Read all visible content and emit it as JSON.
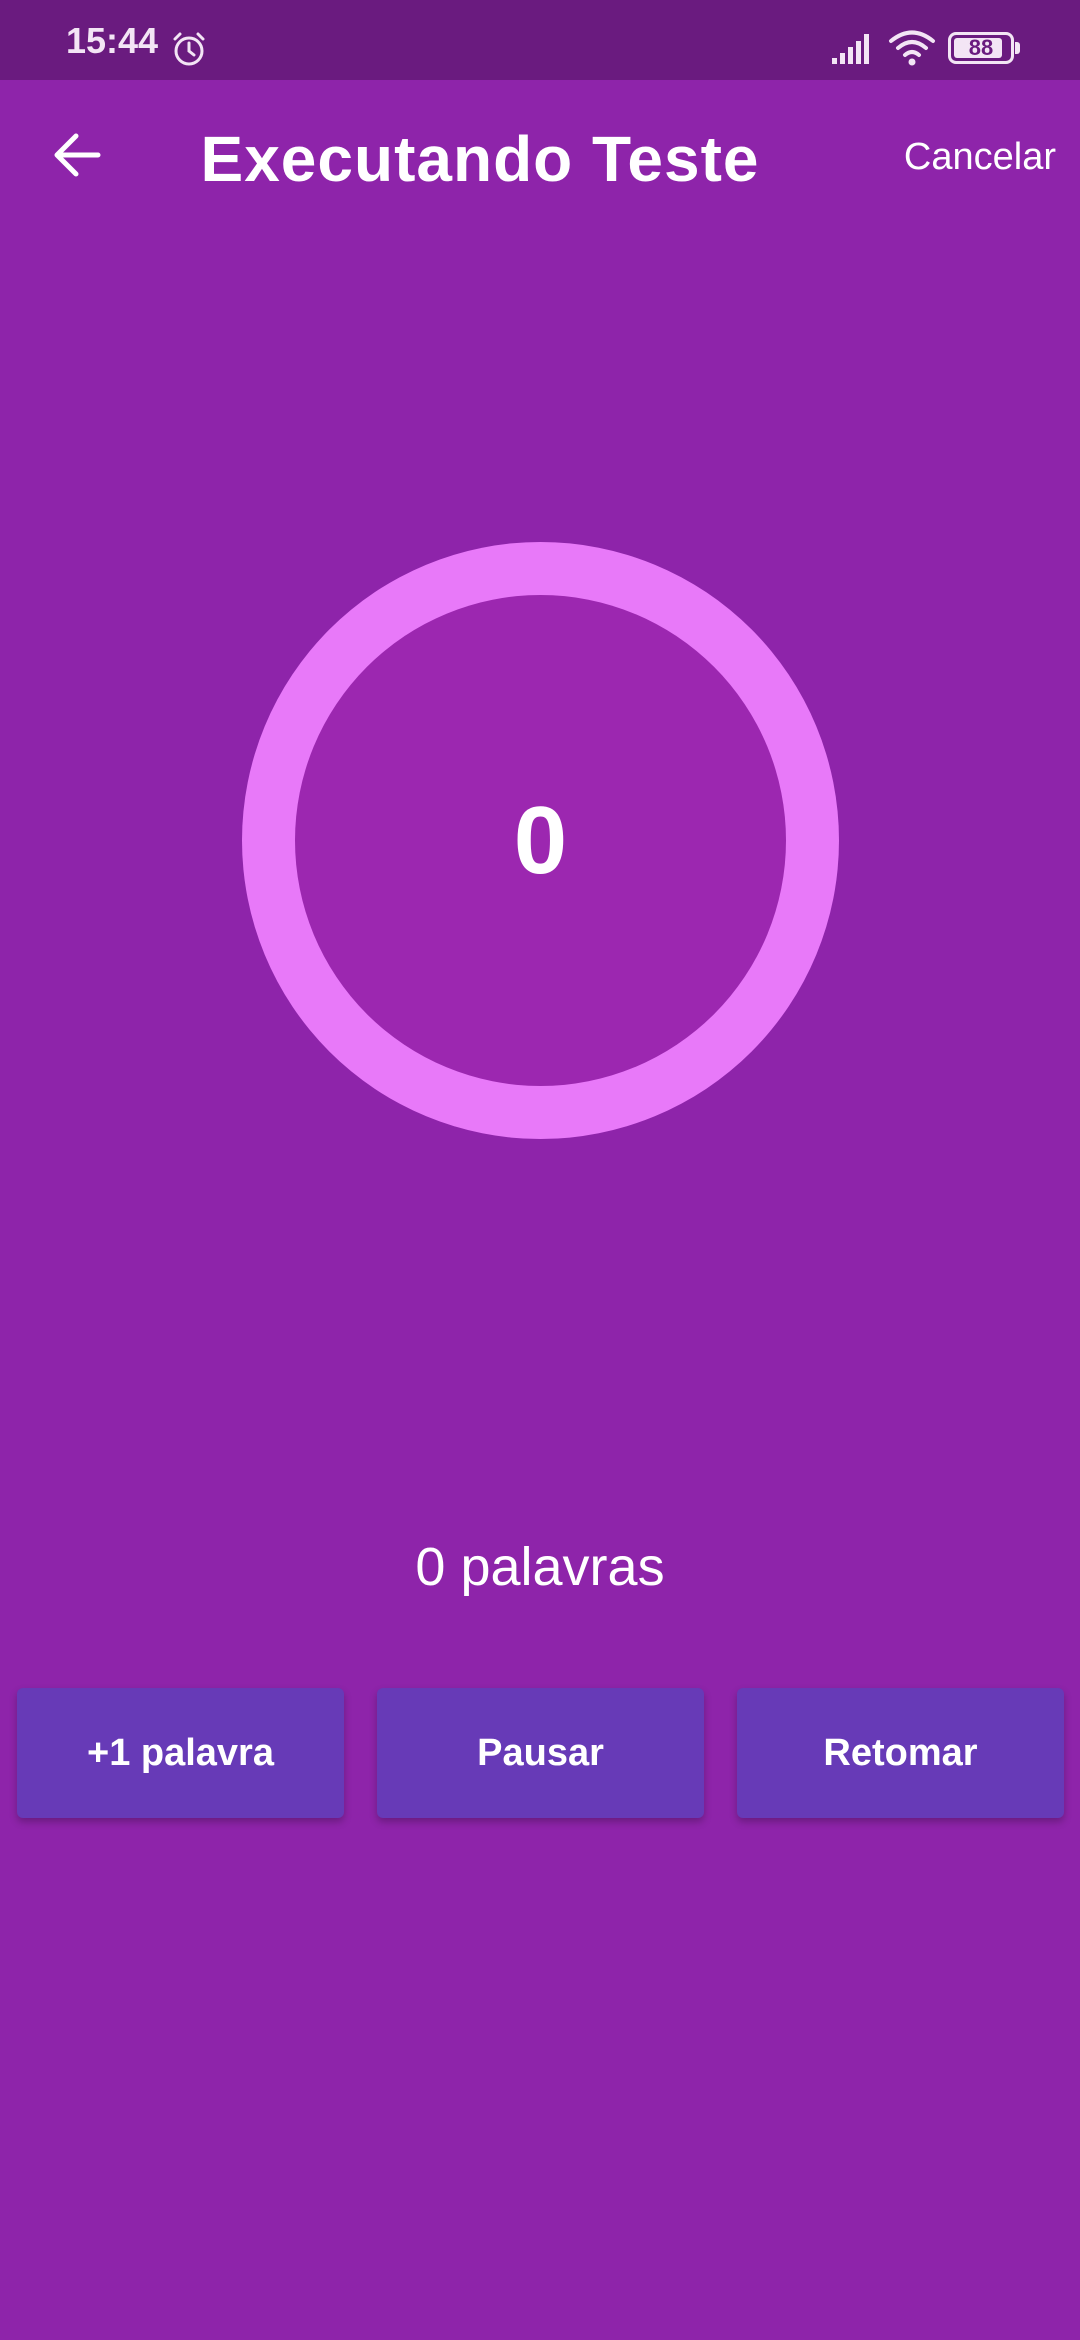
{
  "status_bar": {
    "time": "15:44",
    "battery_level": 88,
    "battery_label": "88",
    "icons": [
      "alarm-icon",
      "signal-icon",
      "wifi-icon",
      "battery-icon"
    ]
  },
  "app_bar": {
    "back_icon": "arrow-left-icon",
    "title": "Executando Teste",
    "cancel_label": "Cancelar"
  },
  "timer": {
    "value": "0",
    "ring_color": "#e879f9",
    "inner_color": "#9c27b0"
  },
  "word_count": "0 palavras",
  "buttons": {
    "add_word": "+1 palavra",
    "pause": "Pausar",
    "resume": "Retomar"
  },
  "colors": {
    "background": "#8e24aa",
    "status_bar": "#6a1b7f",
    "button": "#673ab7"
  }
}
